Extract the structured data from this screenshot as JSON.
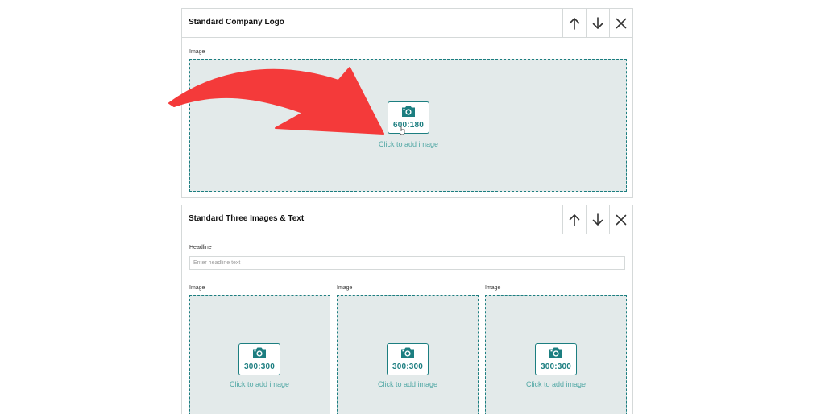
{
  "modules": [
    {
      "title": "Standard Company Logo",
      "image_label": "Image",
      "image_ratio": "600:180",
      "add_image_text": "Click to add image"
    },
    {
      "title": "Standard Three Images & Text",
      "headline_label": "Headline",
      "headline_placeholder": "Enter headline text",
      "images": [
        {
          "label": "Image",
          "ratio": "300:300",
          "add_text": "Click to add image"
        },
        {
          "label": "Image",
          "ratio": "300:300",
          "add_text": "Click to add image"
        },
        {
          "label": "Image",
          "ratio": "300:300",
          "add_text": "Click to add image"
        }
      ]
    }
  ],
  "icons": {
    "move_up": "arrow-up-icon",
    "move_down": "arrow-down-icon",
    "remove": "close-icon",
    "camera": "camera-icon",
    "annotation": "red-curved-arrow"
  },
  "colors": {
    "accent": "#1c7e80",
    "drop_bg": "#e3eaea",
    "annotation_red": "#f43a3a"
  }
}
